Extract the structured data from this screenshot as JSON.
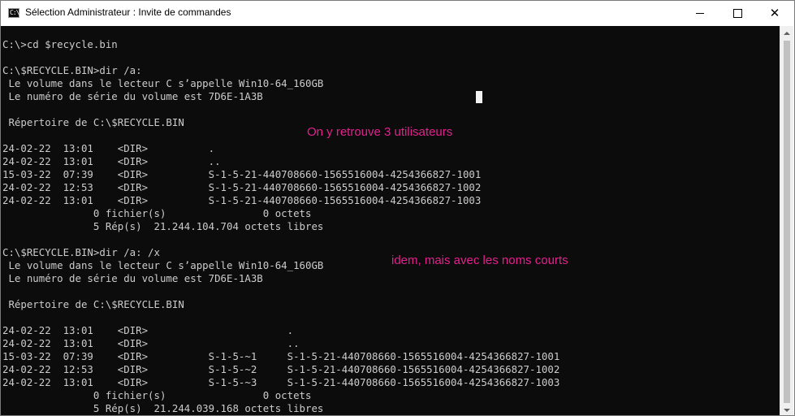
{
  "window": {
    "title": "Sélection Administrateur : Invite de commandes",
    "icon": "cmd-icon",
    "icon_glyph": "C:\\",
    "controls": {
      "minimize": "minimize-icon",
      "maximize": "maximize-icon",
      "close": "close-icon",
      "close_glyph": "✕"
    }
  },
  "console": {
    "background": "#0c0c0c",
    "foreground": "#cccccc",
    "lines": [
      "C:\\>cd $recycle.bin",
      "",
      "C:\\$RECYCLE.BIN>dir /a:",
      " Le volume dans le lecteur C s’appelle Win10-64_160GB",
      " Le numéro de série du volume est 7D6E-1A3B",
      "",
      " Répertoire de C:\\$RECYCLE.BIN",
      "",
      "24-02-22  13:01    <DIR>          .",
      "24-02-22  13:01    <DIR>          ..",
      "15-03-22  07:39    <DIR>          S-1-5-21-440708660-1565516004-4254366827-1001",
      "24-02-22  12:53    <DIR>          S-1-5-21-440708660-1565516004-4254366827-1002",
      "24-02-22  13:01    <DIR>          S-1-5-21-440708660-1565516004-4254366827-1003",
      "               0 fichier(s)                0 octets",
      "               5 Rép(s)  21.244.104.704 octets libres",
      "",
      "C:\\$RECYCLE.BIN>dir /a: /x",
      " Le volume dans le lecteur C s’appelle Win10-64_160GB",
      " Le numéro de série du volume est 7D6E-1A3B",
      "",
      " Répertoire de C:\\$RECYCLE.BIN",
      "",
      "24-02-22  13:01    <DIR>                       .",
      "24-02-22  13:01    <DIR>                       ..",
      "15-03-22  07:39    <DIR>          S-1-5-~1     S-1-5-21-440708660-1565516004-4254366827-1001",
      "24-02-22  12:53    <DIR>          S-1-5-~2     S-1-5-21-440708660-1565516004-4254366827-1002",
      "24-02-22  13:01    <DIR>          S-1-5-~3     S-1-5-21-440708660-1565516004-4254366827-1003",
      "               0 fichier(s)                0 octets",
      "               5 Rép(s)  21.244.039.168 octets libres"
    ]
  },
  "annotations": {
    "color": "#e5208e",
    "first": "On y retrouve 3 utilisateurs",
    "second": "idem, mais avec les noms courts"
  },
  "scrollbar": {
    "up_icon": "scroll-up-arrow-icon",
    "down_icon": "scroll-down-arrow-icon"
  }
}
